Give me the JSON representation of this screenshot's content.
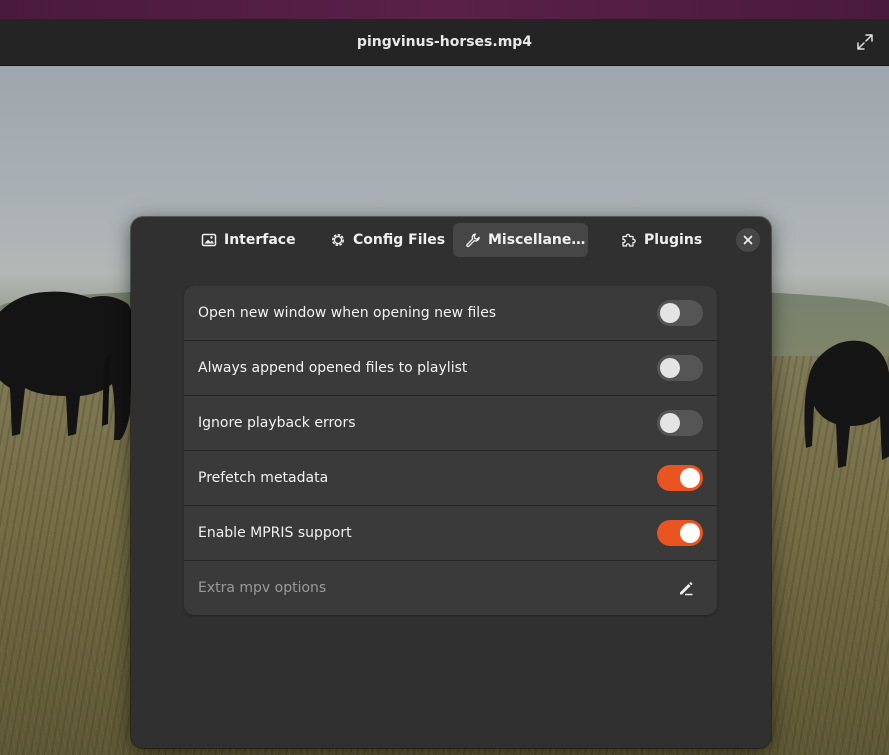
{
  "window": {
    "title": "pingvinus-horses.mp4"
  },
  "dialog": {
    "tabs": [
      {
        "label": "Interface",
        "icon": "image-icon",
        "active": false
      },
      {
        "label": "Config Files",
        "icon": "gear-icon",
        "active": false
      },
      {
        "label": "Miscellane…",
        "icon": "wrench-icon",
        "active": true
      },
      {
        "label": "Plugins",
        "icon": "puzzle-icon",
        "active": false
      }
    ],
    "rows": [
      {
        "label": "Open new window when opening new files",
        "type": "switch",
        "on": false
      },
      {
        "label": "Always append opened files to playlist",
        "type": "switch",
        "on": false
      },
      {
        "label": "Ignore playback errors",
        "type": "switch",
        "on": false
      },
      {
        "label": "Prefetch metadata",
        "type": "switch",
        "on": true
      },
      {
        "label": "Enable MPRIS support",
        "type": "switch",
        "on": true
      },
      {
        "label": "Extra mpv options",
        "type": "entry",
        "placeholder": true
      }
    ]
  },
  "colors": {
    "accent": "#e95420",
    "dialog_bg": "#303030",
    "row_bg": "#3a3a3a",
    "switch_off": "#555555"
  }
}
